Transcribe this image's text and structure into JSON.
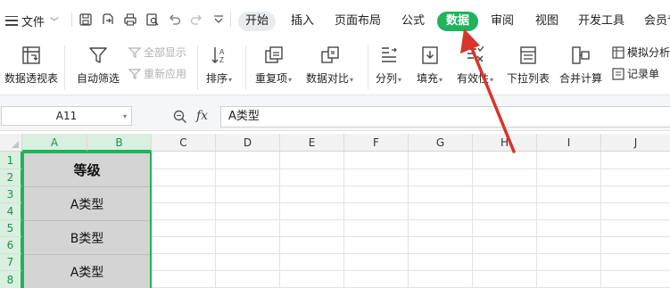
{
  "menubar": {
    "file_label": "文件",
    "tabs": [
      {
        "label": "开始"
      },
      {
        "label": "插入"
      },
      {
        "label": "页面布局"
      },
      {
        "label": "公式"
      },
      {
        "label": "数据"
      },
      {
        "label": "审阅"
      },
      {
        "label": "视图"
      },
      {
        "label": "开发工具"
      },
      {
        "label": "会员专享"
      }
    ],
    "active_tab": "数据",
    "active_color": "#1fb35c"
  },
  "ribbon": {
    "pivot": "数据透视表",
    "autofilter": "自动筛选",
    "show_all": "全部显示",
    "reapply": "重新应用",
    "sort": "排序",
    "duplicates": "重复项",
    "compare": "数据对比",
    "split": "分列",
    "fill": "填充",
    "validity": "有效性",
    "dropdown": "下拉列表",
    "consolidate": "合并计算",
    "simulate": "模拟分析",
    "record": "记录单"
  },
  "formula_bar": {
    "name_box": "A11",
    "fx": "fx",
    "value": "A类型"
  },
  "grid": {
    "columns": [
      "A",
      "B",
      "C",
      "D",
      "E",
      "F",
      "G",
      "H",
      "I",
      "J"
    ],
    "rows": [
      "1",
      "2",
      "3",
      "4",
      "5",
      "6",
      "7",
      "8"
    ],
    "merged_cells": [
      "等级",
      "A类型",
      "B类型",
      "A类型"
    ],
    "selection_color": "#1fb35c"
  },
  "annotation": {
    "arrow_color": "#d9342b"
  }
}
